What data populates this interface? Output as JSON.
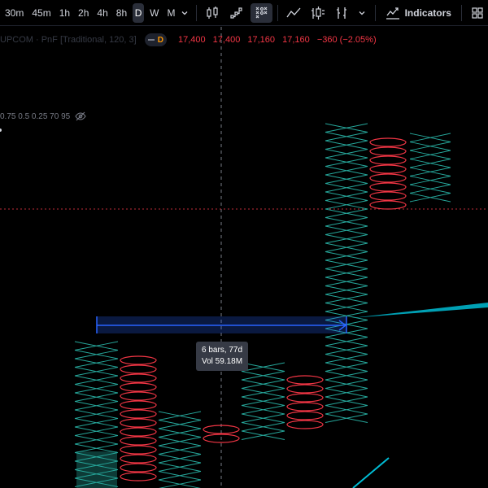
{
  "toolbar": {
    "intervals": [
      "30m",
      "45m",
      "1h",
      "2h",
      "4h",
      "8h",
      "D",
      "W",
      "M"
    ],
    "active_interval": "D",
    "indicators_label": "Indicators",
    "icons": [
      "chevron-down-icon",
      "candles-icon",
      "steps-icon",
      "point-figure-icon",
      "line-chart-icon",
      "bars-icon",
      "renko-icon",
      "chevron-down-icon",
      "indicators-icon",
      "layout-grid-icon"
    ]
  },
  "legend": {
    "symbol": "UPCOM · PnF [Traditional, 120, 3]",
    "badge": "D",
    "open": "17,400",
    "high": "17,400",
    "low": "17,160",
    "close": "17,160",
    "change": "−360 (−2.05%)"
  },
  "subline": {
    "text": "0.75 0.5 0.25 70 95"
  },
  "tooltip": {
    "bars": "6 bars, 77d",
    "vol": "Vol 59.18M"
  },
  "colors": {
    "x_color": "#26a69a",
    "o_color": "#f23645",
    "background": "#000000",
    "measure": "#2962ff",
    "trendline": "#00bcd4"
  }
}
